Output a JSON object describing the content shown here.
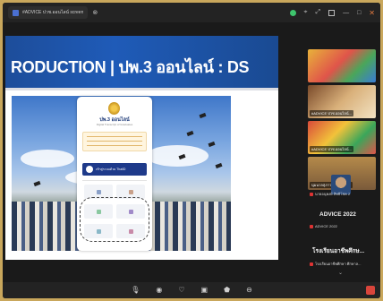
{
  "window": {
    "tab_title": "#ADVICE ปวช.ออนไลน์ screen",
    "controls": [
      "—",
      "□",
      "✕"
    ]
  },
  "slide": {
    "title": "RODUCTION | ปพ.3 ออนไลน์ : DS"
  },
  "card": {
    "name": "ปพ.3 ออนไลน์",
    "subtitle": "Digital Transcript of Graduates",
    "button_label": "เข้าสู่ระบบด้วย ThaiID"
  },
  "participants": [
    {
      "label": "#ADVICE ปวช.ออนไลน์..."
    },
    {
      "label": "#ADVICE ปวช.ออนไลน์..."
    },
    {
      "label": "นุ่มนวลสุภาวะ นักศึกษา..."
    },
    {
      "label": "นายอนุพงษ์ สิทธิโชค 2"
    }
  ],
  "captions": {
    "advice_big": "ADVICE 2022",
    "advice_small": "ADVICE 2022",
    "school_big": "โรงเรียนอาชีพศึกษ...",
    "school_small": "โรงเรียนอาชีพศึกษา ศึกษาล..."
  },
  "toolbar": {
    "icons": [
      "microphone-icon",
      "camera-icon",
      "participants-icon",
      "share-icon",
      "security-icon",
      "more-icon"
    ]
  },
  "colors": {
    "accent_red": "#d9453b",
    "banner_blue": "#1f5bb8",
    "frame_gold": "#c9a75c"
  }
}
